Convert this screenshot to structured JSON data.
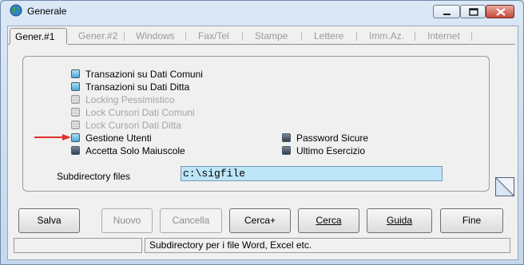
{
  "window": {
    "title": "Generale"
  },
  "tabs": [
    {
      "label": "Gener.#1",
      "active": true
    },
    {
      "label": "Gener.#2"
    },
    {
      "label": "Windows"
    },
    {
      "label": "Fax/Tel"
    },
    {
      "label": "Stampe"
    },
    {
      "label": "Lettere"
    },
    {
      "label": "Imm.Az."
    },
    {
      "label": "Internet"
    }
  ],
  "options_left": [
    {
      "label": "Transazioni su Dati Comuni",
      "state": "on"
    },
    {
      "label": "Transazioni su Dati Ditta",
      "state": "on"
    },
    {
      "label": "Locking Pessimistico",
      "state": "disabled"
    },
    {
      "label": "Lock Cursori Dati Comuni",
      "state": "disabled"
    },
    {
      "label": "Lock Cursori Dati Ditta",
      "state": "disabled"
    },
    {
      "label": "Gestione Utenti",
      "state": "on"
    },
    {
      "label": "Accetta Solo Maiuscole",
      "state": "off"
    }
  ],
  "options_right": [
    {
      "label": "Password Sicure",
      "state": "off"
    },
    {
      "label": "Ultimo Esercizio",
      "state": "off"
    }
  ],
  "subdirectory": {
    "label": "Subdirectory files",
    "value": "c:\\sigfile"
  },
  "buttons": {
    "salva": "Salva",
    "nuovo": "Nuovo",
    "cancella": "Cancella",
    "cerca_plus": "Cerca+",
    "cerca": "Cerca",
    "guida": "Guida",
    "fine": "Fine"
  },
  "status": {
    "left": "",
    "message": "Subdirectory per i file Word, Excel etc."
  },
  "colors": {
    "highlight_field": "#bde5f8",
    "arrow": "#e0322a"
  }
}
